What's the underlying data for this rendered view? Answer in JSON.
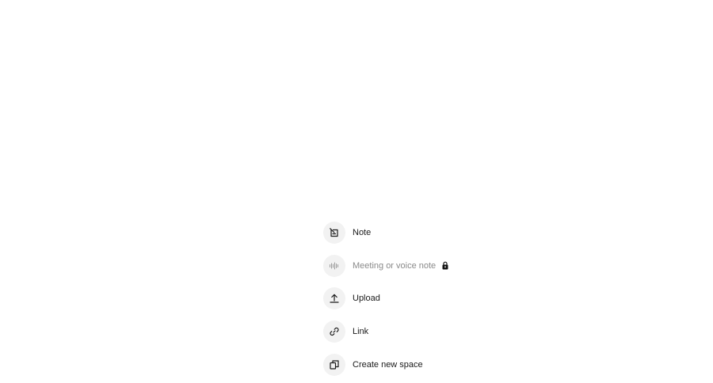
{
  "menu": {
    "items": [
      {
        "id": "note",
        "label": "Note",
        "icon": "note-icon",
        "disabled": false
      },
      {
        "id": "meeting",
        "label": "Meeting or voice note",
        "icon": "waveform-icon",
        "disabled": true,
        "badge_icon": "lock-icon"
      },
      {
        "id": "upload",
        "label": "Upload",
        "icon": "upload-icon",
        "disabled": false
      },
      {
        "id": "link",
        "label": "Link",
        "icon": "link-icon",
        "disabled": false
      },
      {
        "id": "space",
        "label": "Create new space",
        "icon": "copy-space-icon",
        "disabled": false
      }
    ]
  },
  "colors": {
    "background": "#ffffff",
    "icon_circle": "#f2f2f2",
    "text": "#1a1a1a",
    "text_disabled": "#8a8a8a"
  }
}
